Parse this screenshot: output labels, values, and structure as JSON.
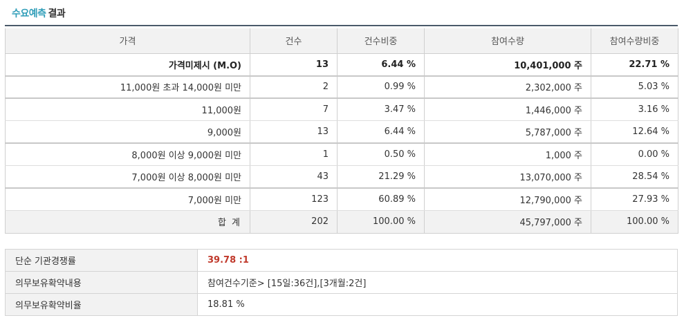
{
  "title": {
    "accent": "수요예측",
    "rest": "결과"
  },
  "headers": [
    "가격",
    "건수",
    "건수비중",
    "참여수량",
    "참여수량비중"
  ],
  "rows": [
    {
      "price": "가격미제시 (M.O)",
      "count": "13",
      "count_ratio": "6.44 %",
      "quantity": "10,401,000 주",
      "quantity_ratio": "22.71 %"
    },
    {
      "price": "11,000원 초과 14,000원 미만",
      "count": "2",
      "count_ratio": "0.99 %",
      "quantity": "2,302,000 주",
      "quantity_ratio": "5.03 %"
    },
    {
      "price": "11,000원",
      "count": "7",
      "count_ratio": "3.47 %",
      "quantity": "1,446,000 주",
      "quantity_ratio": "3.16 %"
    },
    {
      "price": "9,000원",
      "count": "13",
      "count_ratio": "6.44 %",
      "quantity": "5,787,000 주",
      "quantity_ratio": "12.64 %"
    },
    {
      "price": "8,000원 이상 9,000원 미만",
      "count": "1",
      "count_ratio": "0.50 %",
      "quantity": "1,000 주",
      "quantity_ratio": "0.00 %"
    },
    {
      "price": "7,000원 이상 8,000원 미만",
      "count": "43",
      "count_ratio": "21.29 %",
      "quantity": "13,070,000 주",
      "quantity_ratio": "28.54 %"
    },
    {
      "price": "7,000원 미만",
      "count": "123",
      "count_ratio": "60.89 %",
      "quantity": "12,790,000 주",
      "quantity_ratio": "27.93 %"
    }
  ],
  "total": {
    "label": "합 계",
    "count": "202",
    "count_ratio": "100.00 %",
    "quantity": "45,797,000 주",
    "quantity_ratio": "100.00 %"
  },
  "summary": [
    {
      "label": "단순 기관경쟁률",
      "value": "39.78 :1"
    },
    {
      "label": "의무보유확약내용",
      "value": "참여건수기준> [15일:36건],[3개월:2건]"
    },
    {
      "label": "의무보유확약비율",
      "value": "18.81 %"
    }
  ],
  "colors": {
    "accent": "#2f9db8",
    "title_rule": "#4a5a6a",
    "header_bg": "#f2f2f2",
    "ratio_highlight": "#c0392b"
  }
}
